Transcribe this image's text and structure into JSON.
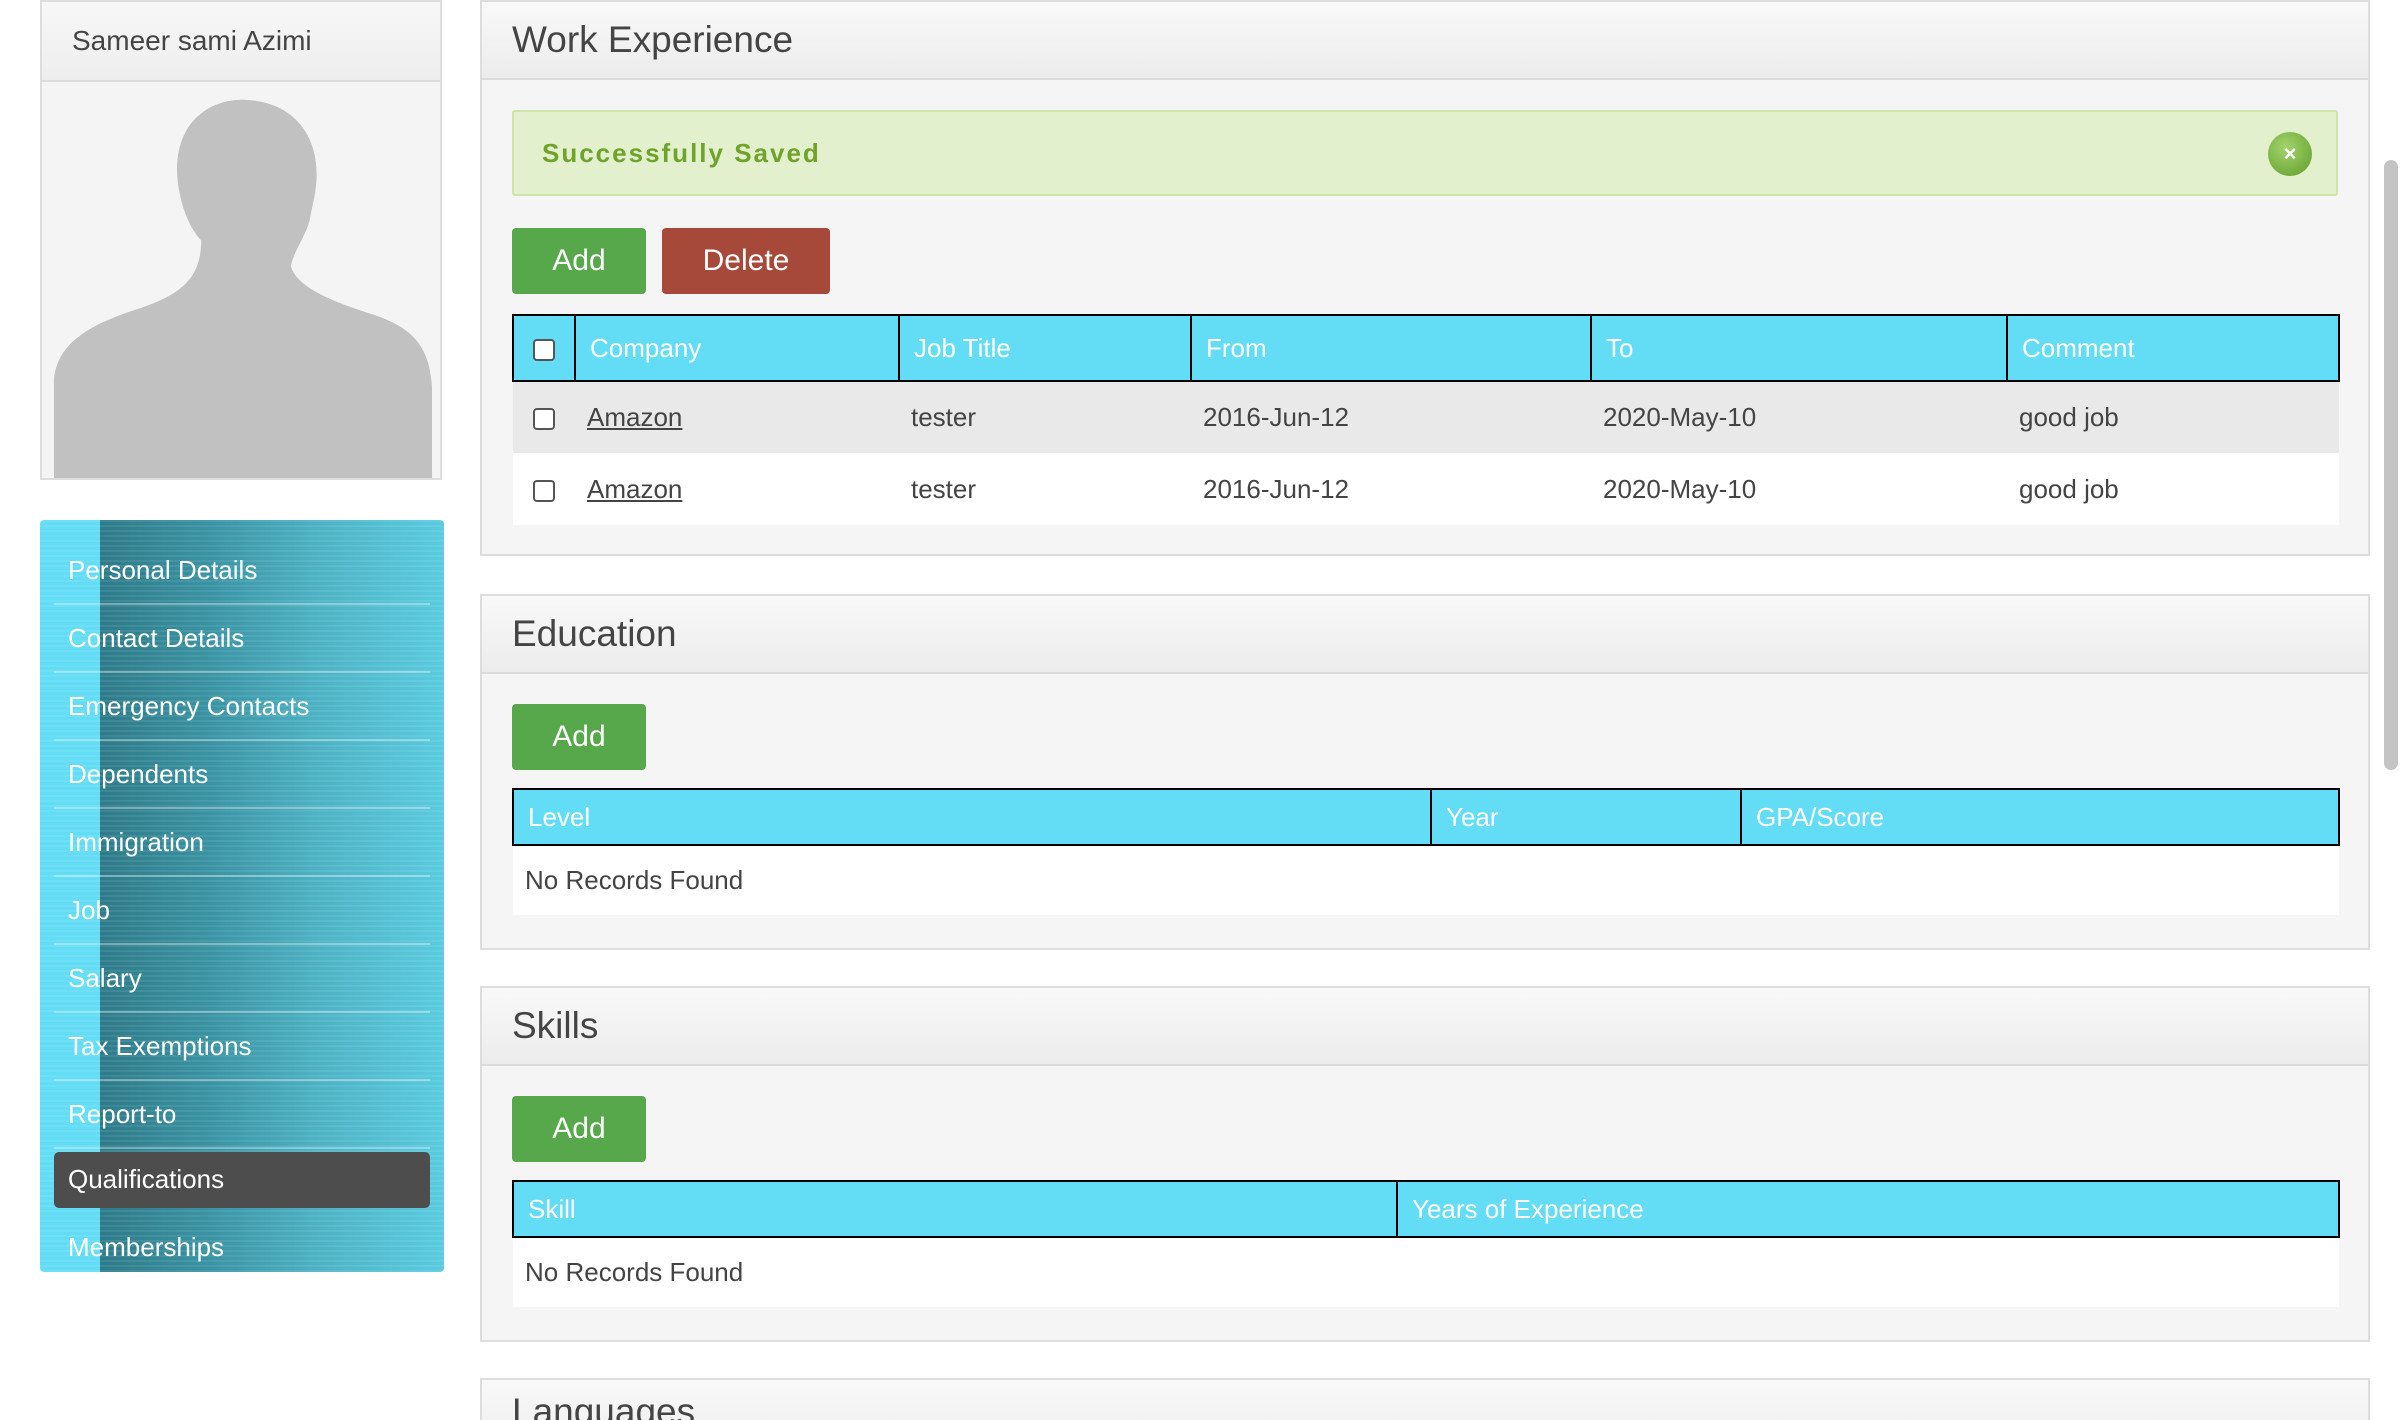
{
  "profile": {
    "name": "Sameer sami Azimi"
  },
  "menu": {
    "items": [
      {
        "label": "Personal Details"
      },
      {
        "label": "Contact Details"
      },
      {
        "label": "Emergency Contacts"
      },
      {
        "label": "Dependents"
      },
      {
        "label": "Immigration"
      },
      {
        "label": "Job"
      },
      {
        "label": "Salary"
      },
      {
        "label": "Tax Exemptions"
      },
      {
        "label": "Report-to"
      },
      {
        "label": "Qualifications"
      },
      {
        "label": "Memberships"
      }
    ],
    "active": "Qualifications"
  },
  "work": {
    "title": "Work Experience",
    "alert_text": "Successfully Saved",
    "alert_close": "×",
    "add_label": "Add",
    "delete_label": "Delete",
    "columns": [
      "Company",
      "Job Title",
      "From",
      "To",
      "Comment"
    ],
    "rows": [
      {
        "company": "Amazon",
        "job_title": "tester",
        "from": "2016-Jun-12",
        "to": "2020-May-10",
        "comment": "good job"
      },
      {
        "company": "Amazon",
        "job_title": "tester",
        "from": "2016-Jun-12",
        "to": "2020-May-10",
        "comment": "good job"
      }
    ]
  },
  "education": {
    "title": "Education",
    "add_label": "Add",
    "columns": [
      "Level",
      "Year",
      "GPA/Score"
    ],
    "empty_text": "No Records Found"
  },
  "skills": {
    "title": "Skills",
    "add_label": "Add",
    "columns": [
      "Skill",
      "Years of Experience"
    ],
    "empty_text": "No Records Found"
  },
  "languages": {
    "title": "Languages"
  },
  "colors": {
    "header_cyan": "#63dcf5",
    "add_green": "#56a84b",
    "delete_red": "#a6493a",
    "success_bg": "#e3f0cd",
    "success_text": "#6fa32a",
    "menu_active": "#4d4d4d"
  }
}
